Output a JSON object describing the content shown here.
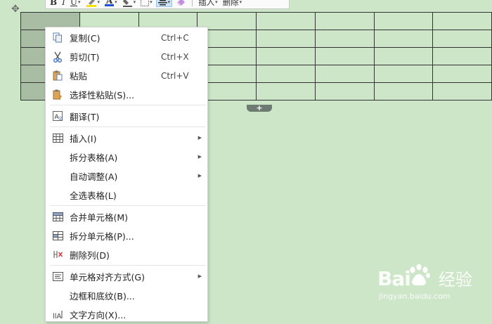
{
  "toolbar": {
    "bold": "B",
    "italic": "I",
    "underline": "U",
    "font_color": "A",
    "insert_label": "插入",
    "delete_label": "删除"
  },
  "table": {
    "rows": 5,
    "cols": 8,
    "add_row_symbol": "+"
  },
  "context_menu": {
    "items": [
      {
        "label": "复制(C)",
        "shortcut": "Ctrl+C",
        "icon": "copy-icon"
      },
      {
        "label": "剪切(T)",
        "shortcut": "Ctrl+X",
        "icon": "scissors-icon"
      },
      {
        "label": "粘贴",
        "shortcut": "Ctrl+V",
        "icon": "paste-icon"
      },
      {
        "label": "选择性粘贴(S)...",
        "shortcut": "",
        "icon": "paste-special-icon"
      },
      {
        "label": "翻译(T)",
        "shortcut": "",
        "icon": "translate-icon"
      },
      {
        "label": "插入(I)",
        "shortcut": "",
        "icon": "insert-table-icon",
        "submenu": true
      },
      {
        "label": "拆分表格(A)",
        "shortcut": "",
        "submenu": true
      },
      {
        "label": "自动调整(A)",
        "shortcut": "",
        "submenu": true
      },
      {
        "label": "全选表格(L)",
        "shortcut": ""
      },
      {
        "label": "合并单元格(M)",
        "shortcut": "",
        "icon": "merge-cells-icon"
      },
      {
        "label": "拆分单元格(P)...",
        "shortcut": "",
        "icon": "split-cells-icon"
      },
      {
        "label": "删除列(D)",
        "shortcut": "",
        "icon": "delete-column-icon"
      },
      {
        "label": "单元格对齐方式(G)",
        "shortcut": "",
        "icon": "cell-align-icon",
        "submenu": true
      },
      {
        "label": "边框和底纹(B)...",
        "shortcut": ""
      },
      {
        "label": "文字方向(X)...",
        "shortcut": "",
        "icon": "text-direction-icon"
      }
    ]
  },
  "watermark": {
    "brand": "Bai",
    "brand_suffix": "经验",
    "url": "jingyan.baidu.com"
  },
  "colors": {
    "page_background": "#cde6c8",
    "selected_column": "#a9bca4",
    "highlight_yellow": "#f5e100",
    "font_color_blue": "#1a4fd6"
  }
}
